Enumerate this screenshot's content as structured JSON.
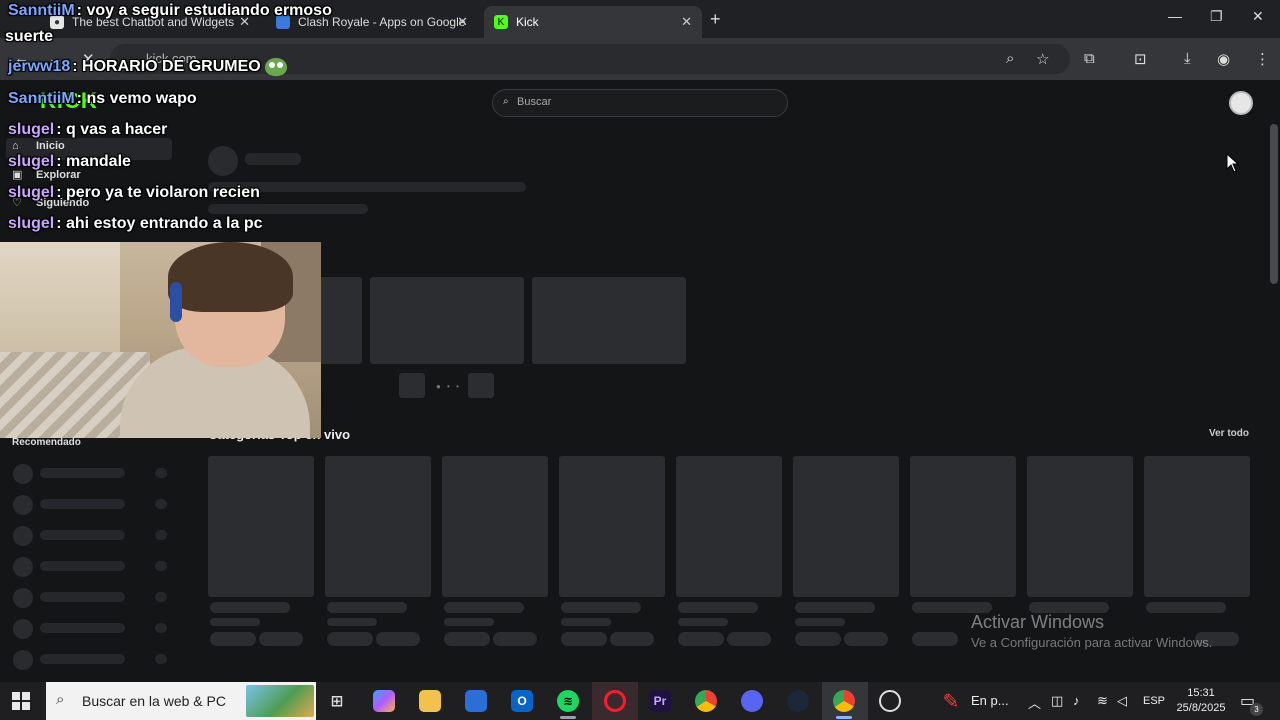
{
  "browser": {
    "tabs": [
      {
        "title": "The best Chatbot and Widgets"
      },
      {
        "title": "Clash Royale - Apps on Google"
      },
      {
        "title": "Kick"
      }
    ],
    "url": "kick.com"
  },
  "page": {
    "logo": "KICK",
    "search_placeholder": "Buscar",
    "sidebar": [
      {
        "label": "Inicio",
        "icon": "home-icon"
      },
      {
        "label": "Explorar",
        "icon": "compass-icon"
      },
      {
        "label": "Siguiendo",
        "icon": "heart-icon"
      }
    ],
    "recommended_title": "Recomendado",
    "section_title": "Categorías Top en vivo",
    "see_all": "Ver todo"
  },
  "chat": [
    {
      "user": "SanntiiM",
      "text": ": voy a seguir estudiando ermoso",
      "color": "#7aa6ff"
    },
    {
      "user": "",
      "text": "suerte",
      "color": "#ffffff"
    },
    {
      "user": "jerww18",
      "text": ": HORARIO DE GRUMEO",
      "color": "#7aa6ff"
    },
    {
      "user": "SanntiiM",
      "text": ": ns vemo wapo",
      "color": "#7aa6ff"
    },
    {
      "user": "slugel",
      "text": ": q vas a hacer",
      "color": "#c9a6ff"
    },
    {
      "user": "slugel",
      "text": ": mandale",
      "color": "#c9a6ff"
    },
    {
      "user": "slugel",
      "text": ": pero ya te violaron recien",
      "color": "#c9a6ff"
    },
    {
      "user": "slugel",
      "text": ": ahi estoy entrando a la pc",
      "color": "#c9a6ff"
    }
  ],
  "watermark": {
    "line1": "Activar Windows",
    "line2": "Ve a Configuración para activar Windows."
  },
  "taskbar": {
    "search_text": "Buscar en la web & PC",
    "notification_app_text": "En p...",
    "language": "ESP",
    "time": "15:31",
    "date": "25/8/2025",
    "notif_count": "3"
  },
  "colors": {
    "kick_green": "#53fc18",
    "page_bg": "#141517",
    "skeleton": "#2c2d30"
  }
}
